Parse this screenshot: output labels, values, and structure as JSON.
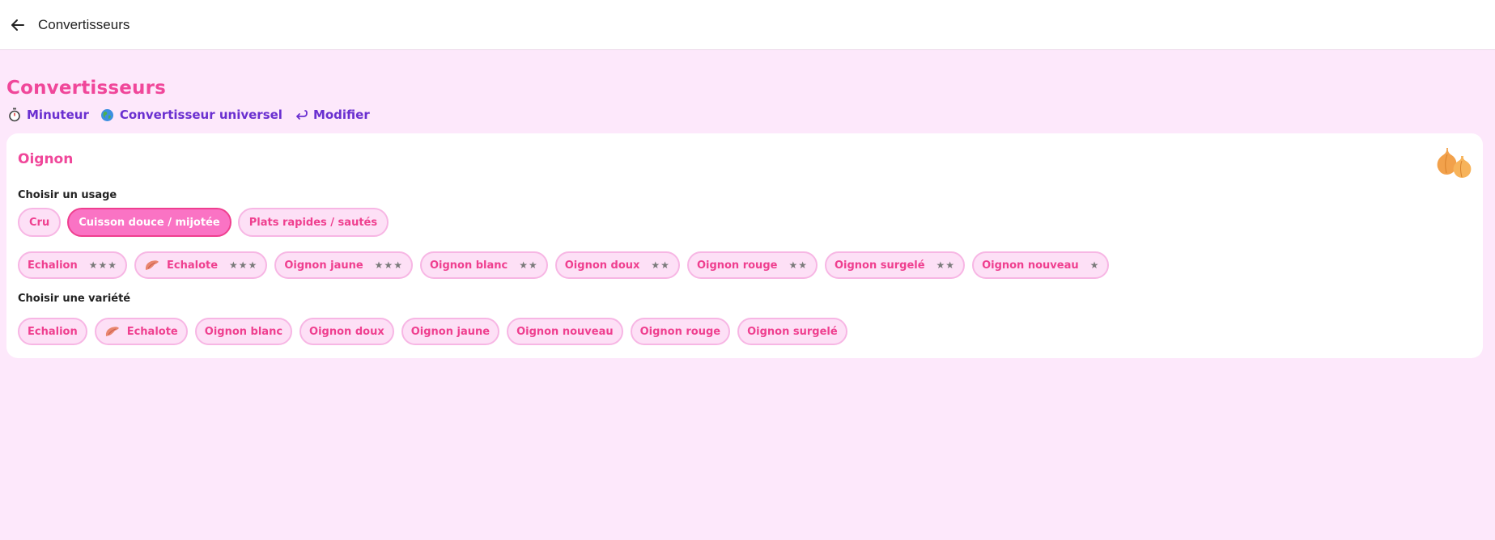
{
  "topbar": {
    "title": "Convertisseurs"
  },
  "page": {
    "title": "Convertisseurs"
  },
  "links": [
    {
      "label": "Minuteur",
      "icon": "stopwatch-icon"
    },
    {
      "label": "Convertisseur universel",
      "icon": "globe-icon"
    },
    {
      "label": "Modifier",
      "icon": "return-arrow-icon"
    }
  ],
  "card": {
    "title": "Oignon",
    "icon": "onion-icon",
    "usage_label": "Choisir un usage",
    "usages": [
      {
        "label": "Cru",
        "selected": false
      },
      {
        "label": "Cuisson douce / mijotée",
        "selected": true
      },
      {
        "label": "Plats rapides / sautés",
        "selected": false
      }
    ],
    "ranked": [
      {
        "label": "Echalion",
        "stars": "★★★"
      },
      {
        "label": "Echalote",
        "stars": "★★★",
        "icon": "shallot-icon"
      },
      {
        "label": "Oignon jaune",
        "stars": "★★★"
      },
      {
        "label": "Oignon blanc",
        "stars": "★★"
      },
      {
        "label": "Oignon doux",
        "stars": "★★"
      },
      {
        "label": "Oignon rouge",
        "stars": "★★"
      },
      {
        "label": "Oignon surgelé",
        "stars": "★★"
      },
      {
        "label": "Oignon nouveau",
        "stars": "★"
      }
    ],
    "variety_label": "Choisir une variété",
    "varieties": [
      {
        "label": "Echalion"
      },
      {
        "label": "Echalote",
        "icon": "shallot-icon"
      },
      {
        "label": "Oignon blanc"
      },
      {
        "label": "Oignon doux"
      },
      {
        "label": "Oignon jaune"
      },
      {
        "label": "Oignon nouveau"
      },
      {
        "label": "Oignon rouge"
      },
      {
        "label": "Oignon surgelé"
      }
    ]
  },
  "colors": {
    "accent_pink": "#f0479a",
    "link_purple": "#6a2fd0",
    "page_bg": "#fde8fb",
    "chip_bg": "#fde0f6",
    "chip_active_bg": "#fa73c4"
  }
}
